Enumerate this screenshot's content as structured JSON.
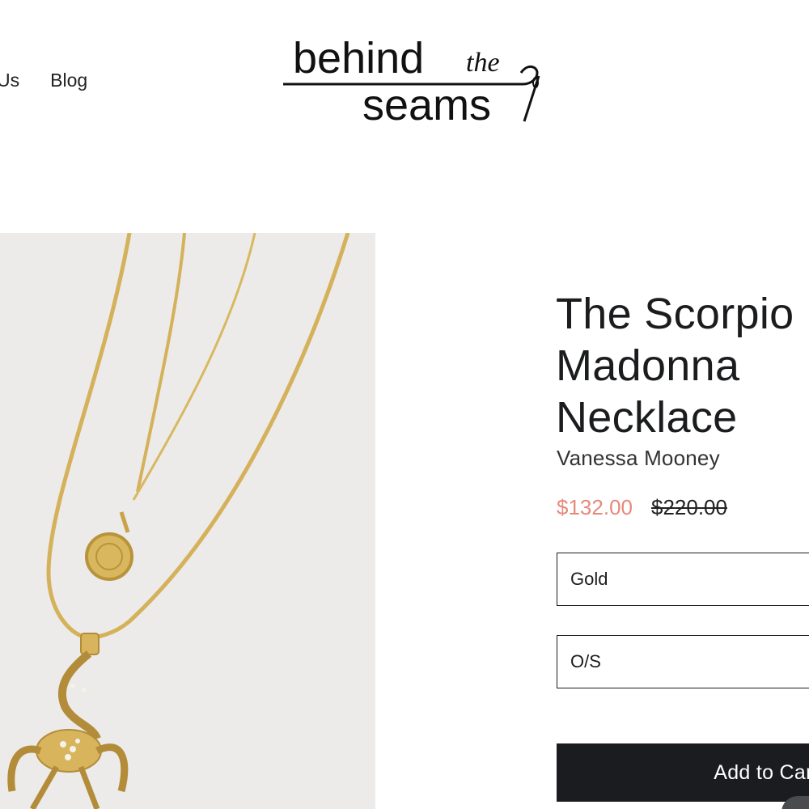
{
  "header": {
    "nav_items": [
      {
        "label": "Us"
      },
      {
        "label": "Blog"
      }
    ],
    "logo": {
      "line1": "behind",
      "script": "the",
      "line2": "seams"
    }
  },
  "product": {
    "title": "The Scorpio Madonna Necklace",
    "vendor": "Vanessa Mooney",
    "sale_price": "$132.00",
    "compare_price": "$220.00",
    "color_option": "Gold",
    "size_option": "O/S",
    "add_to_cart_label": "Add to Cart"
  },
  "colors": {
    "sale_price": "#e6897a",
    "button_bg": "#1b1c1f",
    "image_bg": "#ecebe9",
    "gold": "#d4b15a"
  },
  "icons": {
    "logo_needle": "needle-icon",
    "chat": "chat-icon"
  }
}
